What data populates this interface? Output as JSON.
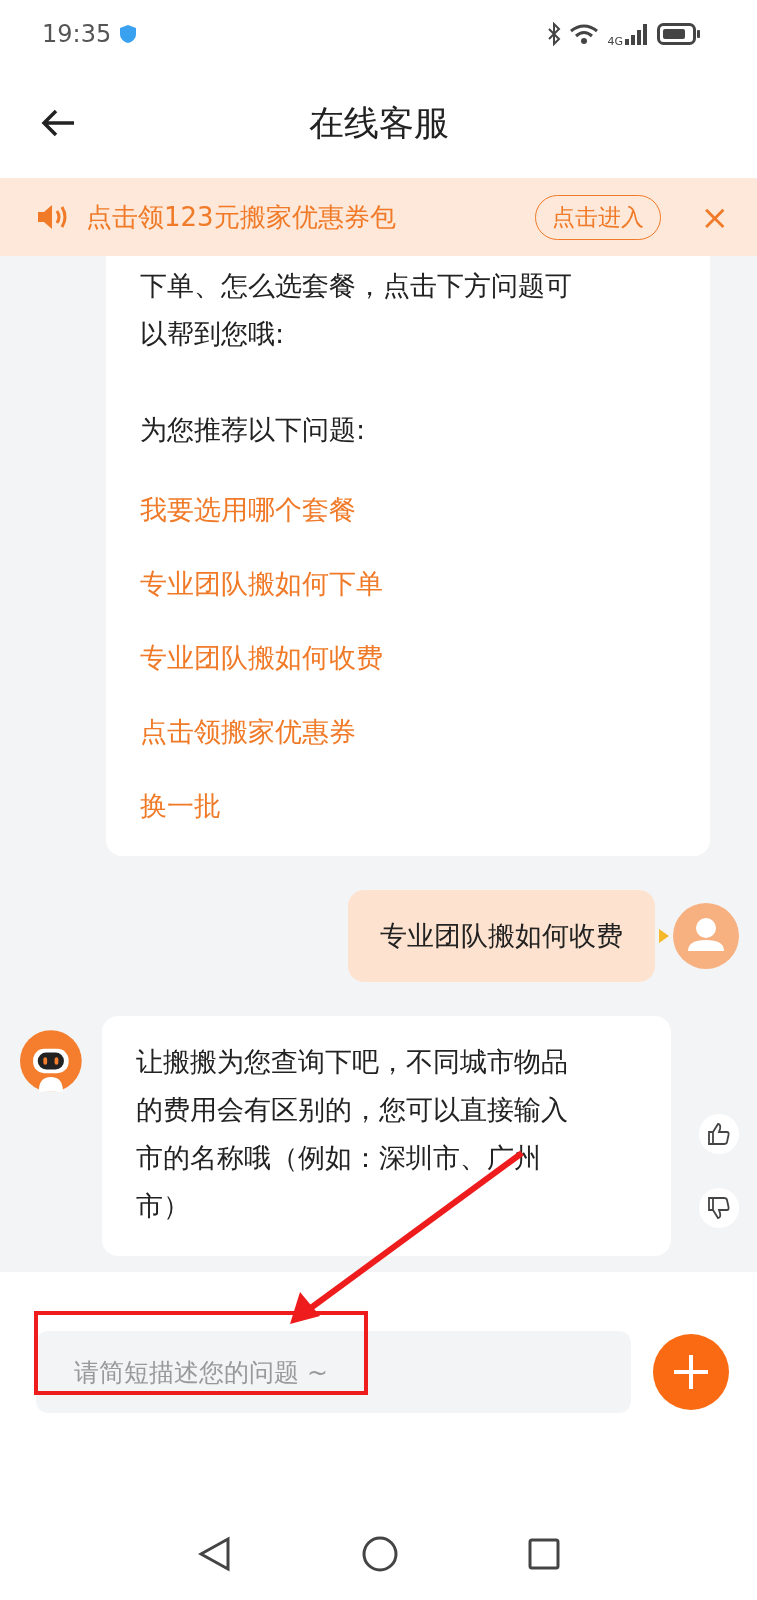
{
  "status_bar": {
    "time": "19:35",
    "network": "4G"
  },
  "header": {
    "title": "在线客服"
  },
  "banner": {
    "text": "点击领123元搬家优惠券包",
    "button": "点击进入",
    "close": "×"
  },
  "messages": [
    {
      "kind": "bot_menu",
      "intro": "下单、怎么选套餐，点击下方问题可以帮到您哦:",
      "heading": "为您推荐以下问题:",
      "questions": [
        "我要选用哪个套餐",
        "专业团队搬如何下单",
        "专业团队搬如何收费",
        "点击领搬家优惠券",
        "换一批"
      ]
    },
    {
      "kind": "user",
      "text": "专业团队搬如何收费"
    },
    {
      "kind": "bot",
      "text": "让搬搬为您查询下吧，不同城市物品的费用会有区别的，您可以直接输入市的名称哦（例如：深圳市、广州市）"
    }
  ],
  "composer": {
    "placeholder": "请简短描述您的问题 ~",
    "highlighted": true
  }
}
